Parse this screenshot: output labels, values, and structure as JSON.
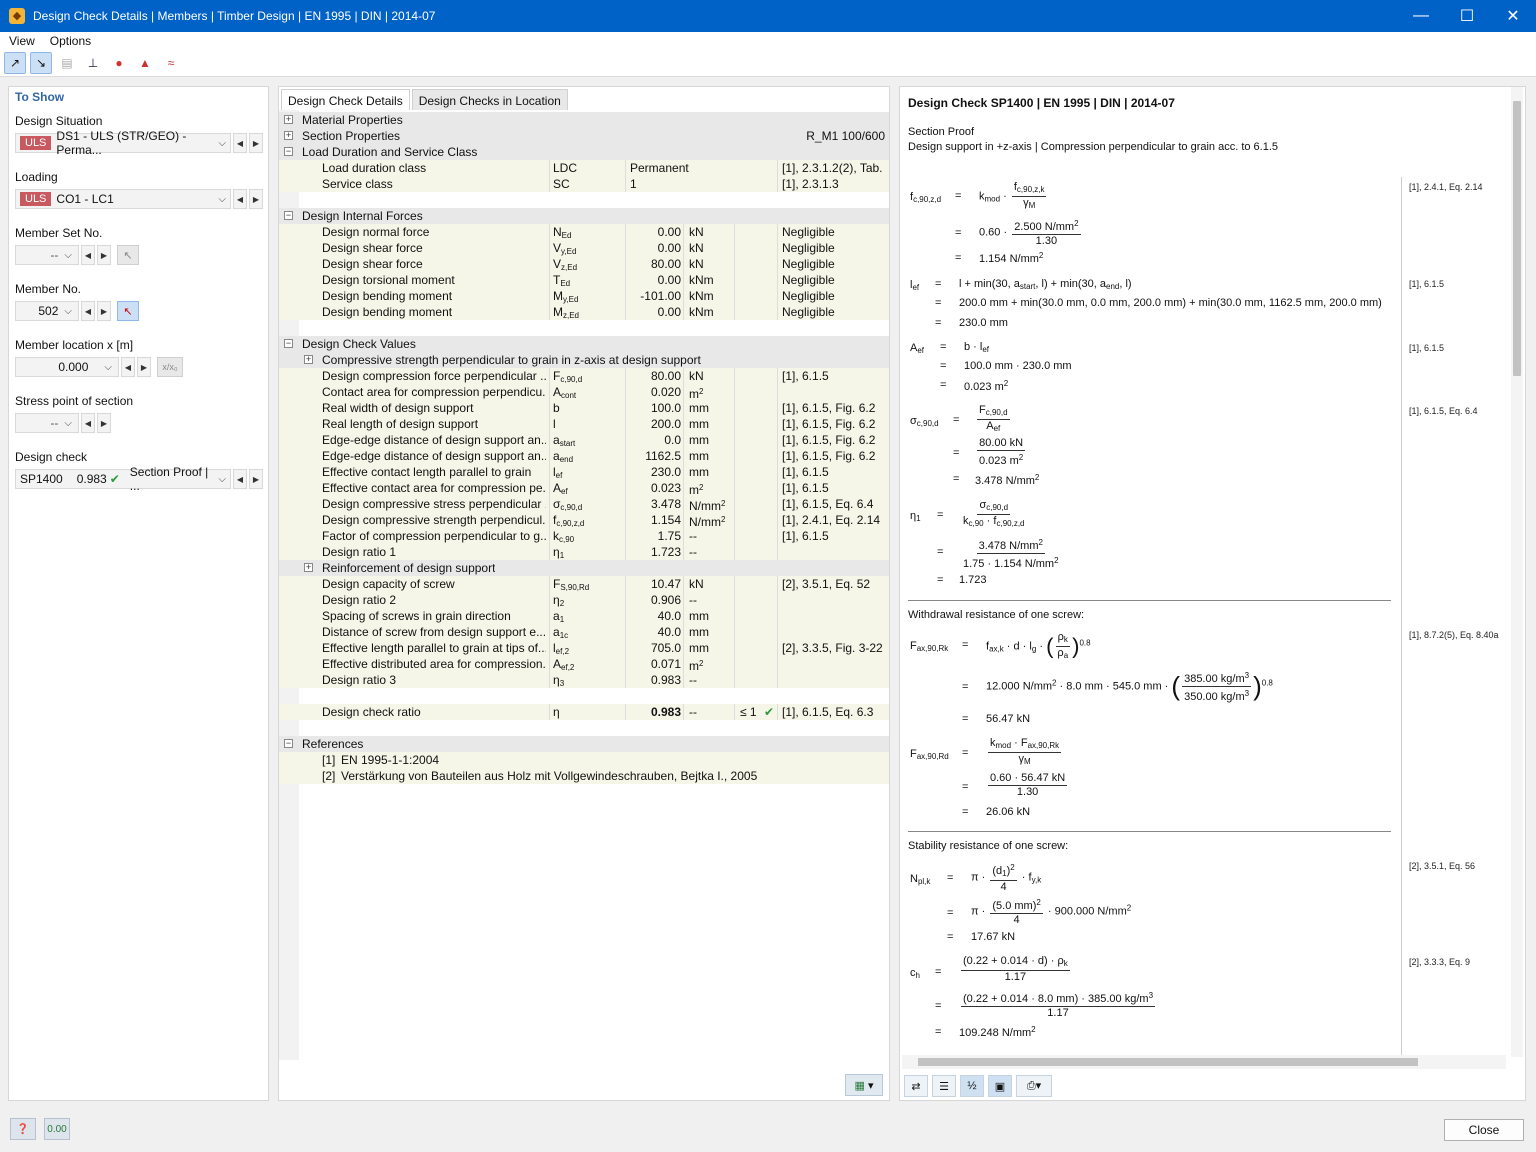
{
  "window": {
    "title": "Design Check Details | Members | Timber Design | EN 1995 | DIN | 2014-07"
  },
  "menu": [
    "View",
    "Options"
  ],
  "left": {
    "heading": "To Show",
    "design_situation": {
      "label": "Design Situation",
      "badge": "ULS",
      "value": "DS1 - ULS (STR/GEO) - Perma..."
    },
    "loading": {
      "label": "Loading",
      "badge": "ULS",
      "value": "CO1 - LC1"
    },
    "member_set": {
      "label": "Member Set No.",
      "value": "--"
    },
    "member_no": {
      "label": "Member No.",
      "value": "502"
    },
    "member_loc": {
      "label": "Member location x [m]",
      "value": "0.000",
      "btn": "x/x₀"
    },
    "stress_point": {
      "label": "Stress point of section",
      "value": "--"
    },
    "design_check": {
      "label": "Design check",
      "id": "SP1400",
      "ratio": "0.983",
      "type": "Section Proof | ..."
    }
  },
  "middle": {
    "tabs": [
      "Design Check Details",
      "Design Checks in Location"
    ],
    "groups": {
      "mat": "Material Properties",
      "sec": "Section Properties",
      "sec_val": "R_M1 100/600",
      "ldsc": "Load Duration and Service Class",
      "dif": "Design Internal Forces",
      "dcv": "Design Check Values",
      "cs": "Compressive strength perpendicular to grain in z-axis at design support",
      "rds": "Reinforcement of design support",
      "refs": "References"
    },
    "ldsc_rows": [
      {
        "desc": "Load duration class",
        "sym": "LDC",
        "val": "Permanent",
        "ref": "[1], 2.3.1.2(2), Tab. ..."
      },
      {
        "desc": "Service class",
        "sym": "SC",
        "val": "1",
        "ref": "[1], 2.3.1.3"
      }
    ],
    "force_rows": [
      {
        "desc": "Design normal force",
        "sym": "N",
        "sub": "Ed",
        "val": "0.00",
        "unit": "kN",
        "ref": "Negligible"
      },
      {
        "desc": "Design shear force",
        "sym": "V",
        "sub": "y,Ed",
        "val": "0.00",
        "unit": "kN",
        "ref": "Negligible"
      },
      {
        "desc": "Design shear force",
        "sym": "V",
        "sub": "z,Ed",
        "val": "80.00",
        "unit": "kN",
        "ref": "Negligible"
      },
      {
        "desc": "Design torsional moment",
        "sym": "T",
        "sub": "Ed",
        "val": "0.00",
        "unit": "kNm",
        "ref": "Negligible"
      },
      {
        "desc": "Design bending moment",
        "sym": "M",
        "sub": "y,Ed",
        "val": "-101.00",
        "unit": "kNm",
        "ref": "Negligible"
      },
      {
        "desc": "Design bending moment",
        "sym": "M",
        "sub": "z,Ed",
        "val": "0.00",
        "unit": "kNm",
        "ref": "Negligible"
      }
    ],
    "cs_rows": [
      {
        "desc": "Design compression force perpendicular ...",
        "sym": "F",
        "sub": "c,90,d",
        "val": "80.00",
        "unit": "kN",
        "ref": "[1], 6.1.5"
      },
      {
        "desc": "Contact area for compression perpendicu...",
        "sym": "A",
        "sub": "cont",
        "val": "0.020",
        "unit": "m",
        "sup": "2",
        "ref": ""
      },
      {
        "desc": "Real width of design support",
        "sym": "b",
        "sub": "",
        "val": "100.0",
        "unit": "mm",
        "ref": "[1], 6.1.5, Fig. 6.2"
      },
      {
        "desc": "Real length of design support",
        "sym": "l",
        "sub": "",
        "val": "200.0",
        "unit": "mm",
        "ref": "[1], 6.1.5, Fig. 6.2"
      },
      {
        "desc": "Edge-edge distance of design support an...",
        "sym": "a",
        "sub": "start",
        "val": "0.0",
        "unit": "mm",
        "ref": "[1], 6.1.5, Fig. 6.2"
      },
      {
        "desc": "Edge-edge distance of design support an...",
        "sym": "a",
        "sub": "end",
        "val": "1162.5",
        "unit": "mm",
        "ref": "[1], 6.1.5, Fig. 6.2"
      },
      {
        "desc": "Effective contact length parallel to grain",
        "sym": "l",
        "sub": "ef",
        "val": "230.0",
        "unit": "mm",
        "ref": "[1], 6.1.5"
      },
      {
        "desc": "Effective contact area for compression pe...",
        "sym": "A",
        "sub": "ef",
        "val": "0.023",
        "unit": "m",
        "sup": "2",
        "ref": "[1], 6.1.5"
      },
      {
        "desc": "Design compressive stress perpendicular ...",
        "sym": "σ",
        "sub": "c,90,d",
        "val": "3.478",
        "unit": "N/mm",
        "sup": "2",
        "ref": "[1], 6.1.5, Eq. 6.4"
      },
      {
        "desc": "Design compressive strength perpendicul...",
        "sym": "f",
        "sub": "c,90,z,d",
        "val": "1.154",
        "unit": "N/mm",
        "sup": "2",
        "ref": "[1], 2.4.1, Eq. 2.14"
      },
      {
        "desc": "Factor of compression perpendicular to g...",
        "sym": "k",
        "sub": "c,90",
        "val": "1.75",
        "unit": "--",
        "ref": "[1], 6.1.5"
      },
      {
        "desc": "Design ratio 1",
        "sym": "η",
        "sub": "1",
        "val": "1.723",
        "unit": "--",
        "ref": ""
      }
    ],
    "rds_rows": [
      {
        "desc": "Design capacity of screw",
        "sym": "F",
        "sub": "S,90,Rd",
        "val": "10.47",
        "unit": "kN",
        "ref": "[2], 3.5.1, Eq. 52"
      },
      {
        "desc": "Design ratio 2",
        "sym": "η",
        "sub": "2",
        "val": "0.906",
        "unit": "--",
        "ref": ""
      },
      {
        "desc": "Spacing of screws in grain direction",
        "sym": "a",
        "sub": "1",
        "val": "40.0",
        "unit": "mm",
        "ref": ""
      },
      {
        "desc": "Distance of screw from design support e...",
        "sym": "a",
        "sub": "1c",
        "val": "40.0",
        "unit": "mm",
        "ref": ""
      },
      {
        "desc": "Effective length parallel to grain at tips of...",
        "sym": "l",
        "sub": "ef,2",
        "val": "705.0",
        "unit": "mm",
        "ref": "[2], 3.3.5, Fig. 3-22"
      },
      {
        "desc": "Effective distributed area for compression...",
        "sym": "A",
        "sub": "ef,2",
        "val": "0.071",
        "unit": "m",
        "sup": "2",
        "ref": ""
      },
      {
        "desc": "Design ratio 3",
        "sym": "η",
        "sub": "3",
        "val": "0.983",
        "unit": "--",
        "ref": ""
      }
    ],
    "ratio_row": {
      "desc": "Design check ratio",
      "sym": "η",
      "val": "0.983",
      "unit": "--",
      "cmp": "≤ 1",
      "ref": "[1], 6.1.5, Eq. 6.3"
    },
    "references": [
      {
        "n": "[1]",
        "t": "EN 1995-1-1:2004"
      },
      {
        "n": "[2]",
        "t": "Verstärkung von Bauteilen aus Holz mit Vollgewindeschrauben, Bejtka I., 2005"
      }
    ]
  },
  "report": {
    "title": "Design Check SP1400 | EN 1995 | DIN | 2014-07",
    "section": "Section Proof",
    "desc": "Design support in +z-axis | Compression perpendicular to grain acc. to 6.1.5",
    "withdrawal": "Withdrawal resistance of one screw:",
    "stability": "Stability resistance of one screw:",
    "refs": [
      "[1], 2.4.1, Eq. 2.14",
      "[1], 6.1.5",
      "[1], 6.1.5",
      "[1], 6.1.5, Eq. 6.4",
      "[1], 8.7.2(5), Eq. 8.40a",
      "[2], 3.5.1, Eq. 56",
      "[2], 3.3.3, Eq. 9"
    ],
    "results": {
      "fc90zd": "1.154 N/mm",
      "lef": "230.0 mm",
      "aef": "0.023 m",
      "sigma": "3.478 N/mm",
      "eta1": "1.723",
      "faxrk": "56.47 kN",
      "faxrd": "26.06 kN",
      "npl": "17.67 kN",
      "ch": "109.248 N/mm"
    }
  },
  "footer": {
    "close": "Close",
    "units_btn": "0.00"
  }
}
